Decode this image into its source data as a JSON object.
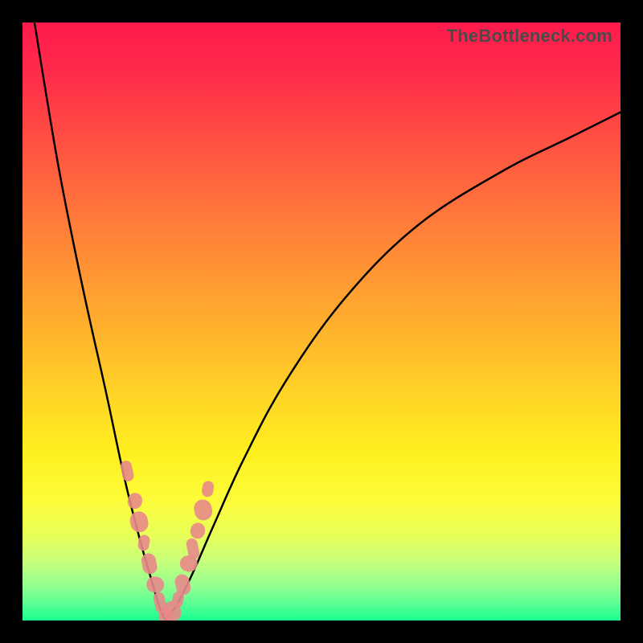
{
  "watermark": "TheBottleneck.com",
  "colors": {
    "frame": "#000000",
    "curve": "#000000",
    "marker": "#e88a8a",
    "gradient_top": "#ff1a4d",
    "gradient_bottom": "#19ff8f"
  },
  "chart_data": {
    "type": "line",
    "title": "",
    "xlabel": "",
    "ylabel": "",
    "xlim": [
      0,
      100
    ],
    "ylim": [
      0,
      100
    ],
    "grid": false,
    "legend": null,
    "annotations": [
      "TheBottleneck.com"
    ],
    "note": "Axes are unlabeled; values are proportional estimates read off the plot area where (0,0) is bottom-left and (100,100) is top-right. y≈0 near the notch at x≈24; y rises toward ~100 at x→0 and toward ~85 at x→100.",
    "series": [
      {
        "name": "left-branch",
        "x": [
          2,
          6,
          10,
          14,
          17,
          19.5,
          21.5,
          23,
          24
        ],
        "y": [
          100,
          76,
          56,
          38,
          24,
          14,
          7,
          2,
          0
        ]
      },
      {
        "name": "right-branch",
        "x": [
          24,
          26,
          28.5,
          32,
          37,
          44,
          54,
          66,
          80,
          92,
          100
        ],
        "y": [
          0,
          3,
          8,
          16,
          27,
          40,
          54,
          66,
          75,
          81,
          85
        ]
      }
    ],
    "markers": {
      "name": "highlight-cluster",
      "x": [
        17.5,
        18.8,
        19.5,
        20.3,
        21.2,
        22.2,
        23.0,
        24.0,
        25.0,
        26.0,
        26.8,
        27.8,
        28.5,
        29.3,
        30.2,
        31.0
      ],
      "y": [
        25.0,
        20.0,
        16.5,
        13.0,
        9.5,
        6.0,
        3.0,
        0.8,
        1.5,
        3.5,
        6.0,
        9.5,
        12.0,
        15.0,
        18.5,
        22.0
      ]
    }
  }
}
